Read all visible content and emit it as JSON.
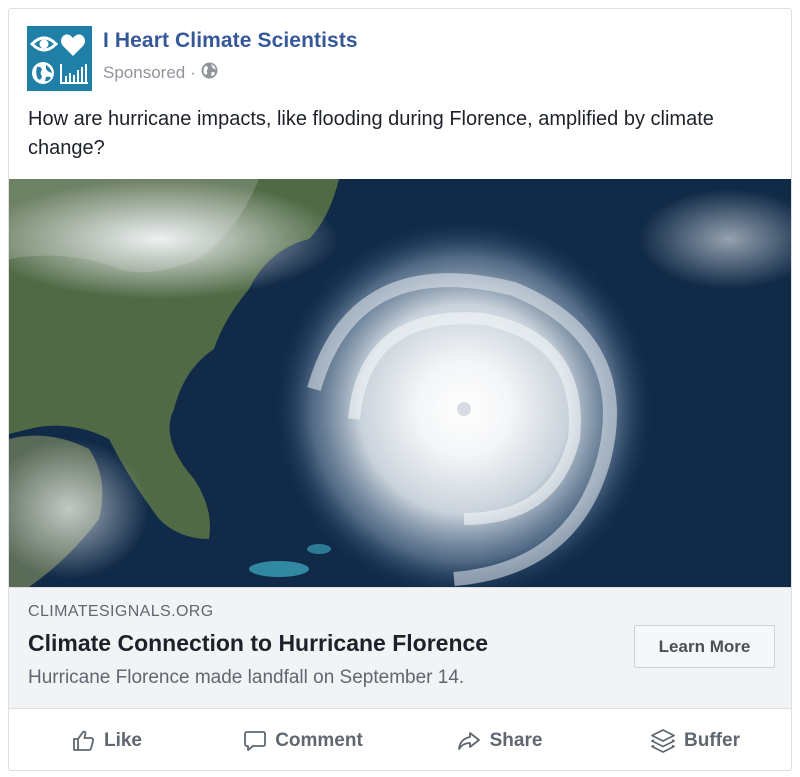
{
  "post": {
    "page_name": "I Heart Climate Scientists",
    "sponsored_label": "Sponsored",
    "separator": "·",
    "text": "How are hurricane impacts, like flooding during Florence, amplified by climate change?",
    "avatar_icons": [
      "eye-icon",
      "heart-icon",
      "globe-icon",
      "bar-chart-icon"
    ],
    "audience_icon": "globe-icon"
  },
  "image": {
    "description_icon": "hurricane-satellite-image"
  },
  "link": {
    "domain": "CLIMATESIGNALS.ORG",
    "title": "Climate Connection to Hurricane Florence",
    "description": "Hurricane Florence made landfall on September 14.",
    "cta_label": "Learn More"
  },
  "actions": [
    {
      "label": "Like",
      "icon": "thumbs-up-icon"
    },
    {
      "label": "Comment",
      "icon": "comment-icon"
    },
    {
      "label": "Share",
      "icon": "share-arrow-icon"
    },
    {
      "label": "Buffer",
      "icon": "buffer-stack-icon"
    }
  ],
  "colors": {
    "page_name": "#365899",
    "avatar_bg": "#1f7fa6",
    "text": "#1d2129",
    "muted": "#606770",
    "link_bg": "#f2f3f5"
  }
}
